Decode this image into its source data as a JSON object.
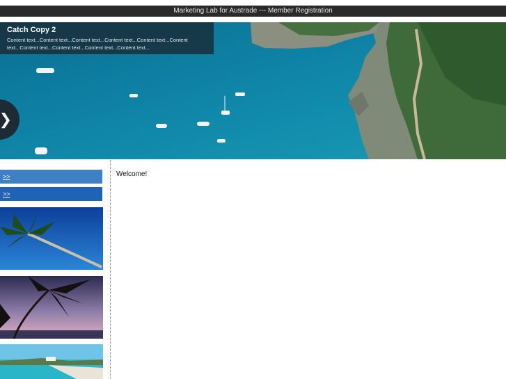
{
  "window": {
    "title": "Marketing Lab for Austrade --- Member Registration"
  },
  "hero": {
    "caption_title": "Catch Copy 2",
    "caption_text": "Content text...Content text...Content text...Content text...Content text...Content text...Content text...Content text...Content text...Content text...",
    "next_button": "❯"
  },
  "sidebar": {
    "nav": [
      {
        "label": ">>"
      },
      {
        "label": ">>"
      }
    ],
    "thumbnails": [
      "palm-tree-beach",
      "palm-sunset",
      "tropical-coast"
    ]
  },
  "main": {
    "welcome": "Welcome!"
  },
  "colors": {
    "titlebar": "#2a2a2a",
    "nav_light": "#3f80c4",
    "nav_dark": "#1f63b8",
    "sea": "#0f7fa2"
  }
}
